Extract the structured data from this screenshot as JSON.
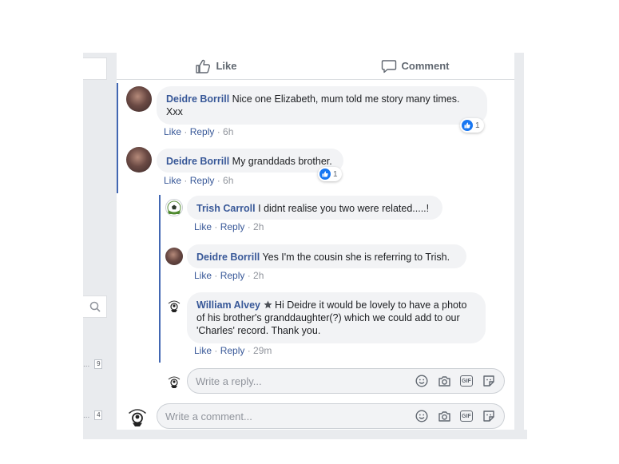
{
  "actions": {
    "like_label": "Like",
    "comment_label": "Comment"
  },
  "left": {
    "badge1": "9",
    "badge2": "4",
    "dots": "..."
  },
  "meta": {
    "like": "Like",
    "reply": "Reply",
    "sep": " · "
  },
  "comments": [
    {
      "author": "Deidre Borrill",
      "text": "Nice one Elizabeth, mum told me story many times.",
      "text2": "Xxx",
      "time": "6h",
      "reactions": "1"
    },
    {
      "author": "Deidre Borrill",
      "text": "My granddads brother.",
      "time": "6h",
      "reactions": "1"
    }
  ],
  "replies": [
    {
      "author": "Trish Carroll",
      "text": "I didnt realise you two were related.....!",
      "time": "2h"
    },
    {
      "author": "Deidre Borrill",
      "text": "Yes I'm the cousin she is referring to Trish.",
      "time": "2h"
    },
    {
      "author": "William Alvey",
      "line1": "Hi Deidre it would be lovely to have a photo",
      "line2": "of his brother's granddaughter(?) which we could add to our",
      "line3": "'Charles' record. Thank you.",
      "time": "29m"
    }
  ],
  "reply_box": {
    "placeholder": "Write a reply..."
  },
  "comment_box": {
    "placeholder": "Write a comment..."
  },
  "icons": [
    "thumbs-up-icon",
    "comment-icon",
    "search-icon",
    "like-reaction-icon",
    "star-icon",
    "emoji-icon",
    "camera-icon",
    "gif-icon",
    "sticker-icon"
  ],
  "colors": {
    "link": "#385898",
    "thread": "#4267b2",
    "bubble": "#f2f3f5",
    "like_blue": "#1877f2"
  }
}
